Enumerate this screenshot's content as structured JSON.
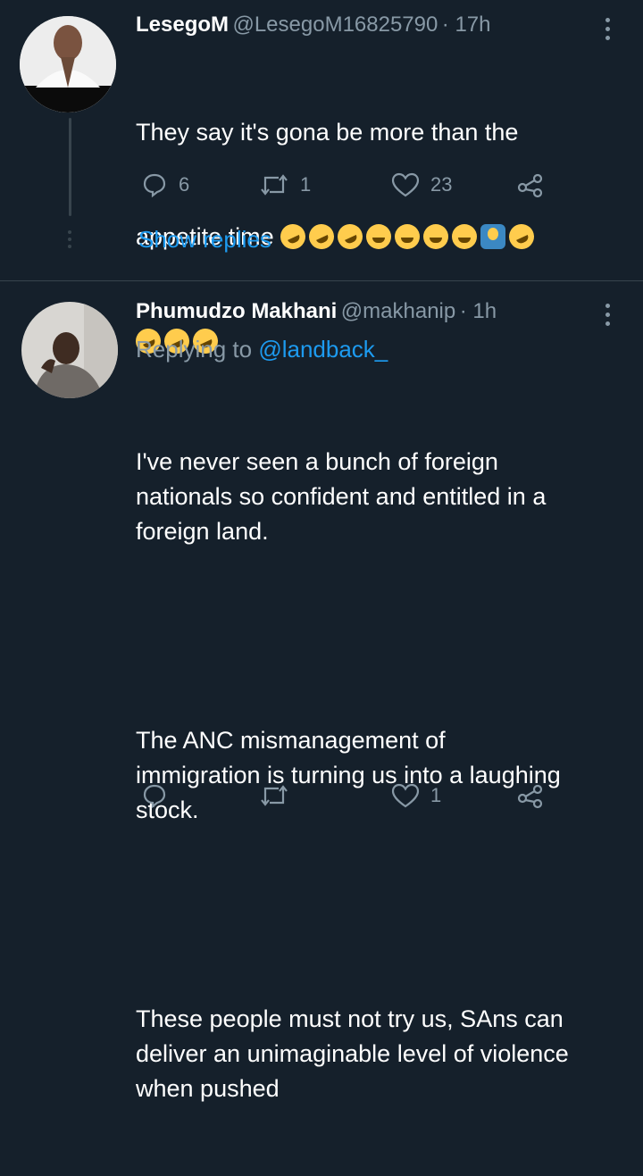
{
  "tweet1": {
    "name": "LesegoM",
    "handle": "@LesegoM16825790",
    "time": "· 17h",
    "text_line1": "They say it's gona be more than the",
    "text_line2": "appetite time",
    "emojis_line2": [
      "rolling-on-floor-laughing",
      "rolling-on-floor-laughing",
      "rolling-on-floor-laughing",
      "face-with-tears-of-joy",
      "face-with-tears-of-joy",
      "face-with-tears-of-joy",
      "face-with-tears-of-joy",
      "person-gesturing-ok",
      "rolling-on-floor-laughing"
    ],
    "emojis_line3": [
      "rolling-on-floor-laughing",
      "rolling-on-floor-laughing",
      "rolling-on-floor-laughing"
    ],
    "replies": "6",
    "retweets": "1",
    "likes": "23",
    "show_replies": "Show replies"
  },
  "tweet2": {
    "name": "Phumudzo Makhani",
    "handle": "@makhanip",
    "time": "· 1h",
    "replying_prefix": "Replying to",
    "replying_to": "@landback_",
    "para1": "I've never seen a bunch of foreign\nnationals so confident and entitled in a\nforeign land.",
    "para2": "The ANC mismanagement of\nimmigration is turning us into a laughing\nstock.",
    "para3": "These people must not try us, SAns can\ndeliver an unimaginable level of violence\nwhen pushed",
    "replies": "",
    "retweets": "",
    "likes": "1"
  },
  "colors": {
    "background": "#15202b",
    "secondary_text": "#8899a6",
    "link": "#1d9bf0",
    "divider": "#38444d"
  }
}
